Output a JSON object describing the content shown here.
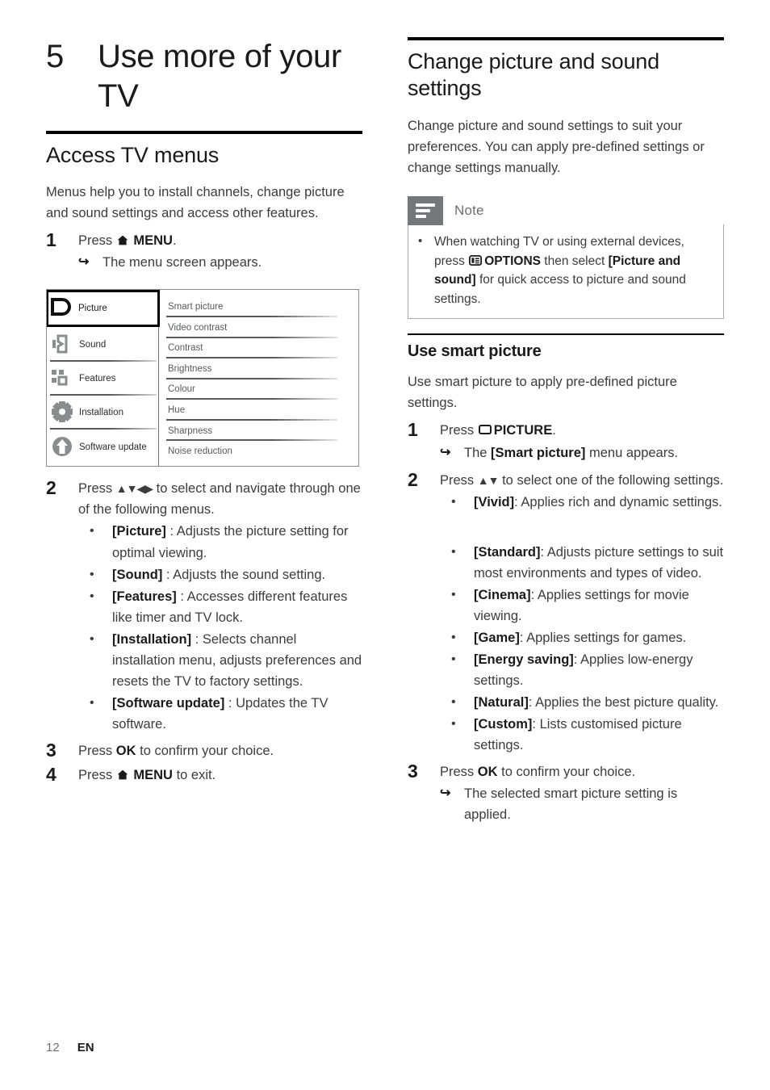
{
  "document": {
    "footer": {
      "page_number": "12",
      "language": "EN"
    }
  },
  "chapter": {
    "number": "5",
    "title": "Use more of your TV"
  },
  "left_column": {
    "section_title": "Access TV menus",
    "intro": "Menus help you to install channels, change picture and sound settings and access other features.",
    "step1": {
      "number": "1",
      "text_before": "Press",
      "icon": "home-icon",
      "key": "MENU",
      "text_after": ".",
      "result": "The menu screen appears."
    },
    "tv_menu_screenshot": {
      "categories": [
        {
          "label": "Picture",
          "icon": "picture-icon",
          "selected": true
        },
        {
          "label": "Sound",
          "icon": "sound-speaker-icon",
          "selected": false
        },
        {
          "label": "Features",
          "icon": "features-blocks-icon",
          "selected": false
        },
        {
          "label": "Installation",
          "icon": "gear-icon",
          "selected": false
        },
        {
          "label": "Software update",
          "icon": "upload-arrow-icon",
          "selected": false
        }
      ],
      "items": [
        "Smart picture",
        "Video contrast",
        "Contrast",
        "Brightness",
        "Colour",
        "Hue",
        "Sharpness",
        "Noise reduction"
      ]
    },
    "step2": {
      "number": "2",
      "text_before": "Press",
      "arrows": "▲▼◀▶",
      "text_after": "to select and navigate through one of the following menus.",
      "bullets": [
        {
          "term": "[Picture]",
          "desc": " : Adjusts the picture setting for optimal viewing."
        },
        {
          "term": "[Sound]",
          "desc": " : Adjusts the sound setting."
        },
        {
          "term": "[Features]",
          "desc": " : Accesses different features like timer and TV lock."
        },
        {
          "term": "[Installation]",
          "desc": " : Selects channel installation menu, adjusts preferences and resets the TV to factory settings."
        },
        {
          "term": "[Software update]",
          "desc": " : Updates the TV software."
        }
      ]
    },
    "step3": {
      "number": "3",
      "text_before": "Press",
      "key": "OK",
      "text_after": "to confirm your choice."
    },
    "step4": {
      "number": "4",
      "text_before": "Press",
      "icon": "home-icon",
      "key": "MENU",
      "text_after": "to exit."
    }
  },
  "right_column": {
    "section_title": "Change picture and sound settings",
    "intro": "Change picture and sound settings to suit your preferences. You can apply pre-defined settings or change settings manually.",
    "note": {
      "title": "Note",
      "icon": "note-lines-icon",
      "bullet_part1": "When watching TV or using external devices, press",
      "icon_inline": "options-icon",
      "key": "OPTIONS",
      "bullet_part2": "then select",
      "bold_term": "[Picture and sound]",
      "bullet_part3": "for quick access to picture and sound settings."
    },
    "subsection_title": "Use smart picture",
    "sub_intro": "Use smart picture to apply pre-defined picture settings.",
    "step1": {
      "number": "1",
      "text_before": "Press",
      "icon": "picture-key-icon",
      "key": "PICTURE",
      "text_after": ".",
      "result_before": "The",
      "result_bold": "[Smart picture]",
      "result_after": "menu appears."
    },
    "step2": {
      "number": "2",
      "text_before": "Press",
      "arrows": "▲▼",
      "text_after": "to select one of the following settings.",
      "bullets_group1": [
        {
          "term": "[Vivid]",
          "desc": ": Applies rich and dynamic settings."
        }
      ],
      "bullets_group2": [
        {
          "term": "[Standard]",
          "desc": ": Adjusts picture settings to suit most environments and types of video."
        },
        {
          "term": "[Cinema]",
          "desc": ": Applies settings for movie viewing."
        },
        {
          "term": "[Game]",
          "desc": ": Applies settings for games."
        },
        {
          "term": "[Energy saving]",
          "desc": ": Applies low-energy settings."
        },
        {
          "term": "[Natural]",
          "desc": ": Applies the best picture quality."
        },
        {
          "term": "[Custom]",
          "desc": ": Lists customised picture settings."
        }
      ]
    },
    "step3": {
      "number": "3",
      "text_before": "Press",
      "key": "OK",
      "text_after": "to confirm your choice.",
      "result": "The selected smart picture setting is applied."
    }
  },
  "colors": {
    "text": "#3c3c3c",
    "heading": "#1a1a1a",
    "note_tab": "#76777b",
    "note_border": "#a7a9ac",
    "menu_item": "#58595b"
  }
}
